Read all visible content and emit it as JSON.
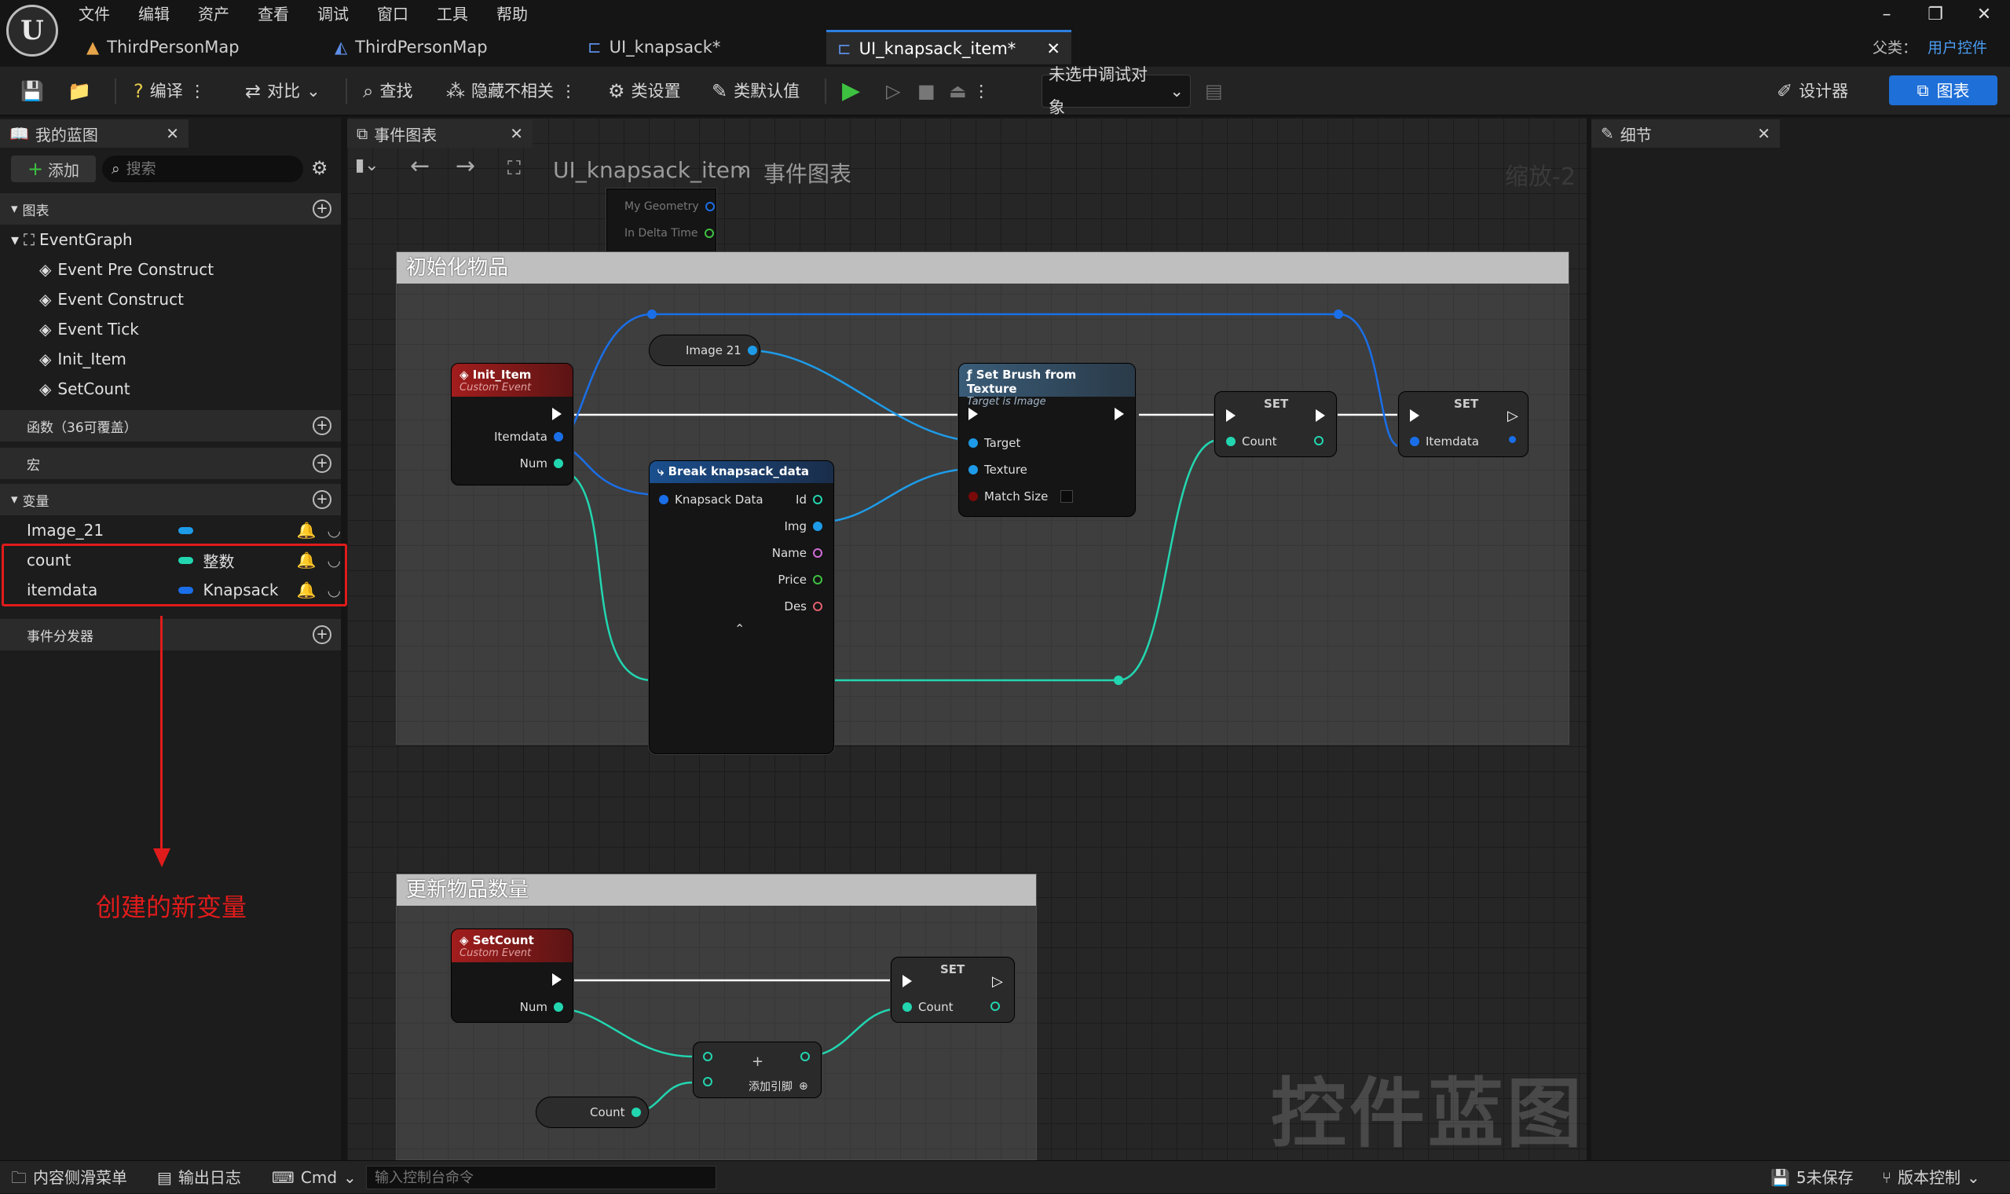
{
  "app": {
    "logo": "U",
    "menu": [
      "文件",
      "编辑",
      "资产",
      "查看",
      "调试",
      "窗口",
      "工具",
      "帮助"
    ],
    "tabs": [
      {
        "label": "ThirdPersonMap",
        "icon": "map-icon"
      },
      {
        "label": "ThirdPersonMap",
        "icon": "level-icon"
      },
      {
        "label": "UI_knapsack*",
        "icon": "widget-icon"
      },
      {
        "label": "UI_knapsack_item*",
        "icon": "widget-icon"
      }
    ],
    "parent_label": "父类：",
    "parent_value": "用户控件"
  },
  "toolbar": {
    "compile": "编译",
    "diff": "对比",
    "find": "查找",
    "hide": "隐藏不相关",
    "class_settings": "类设置",
    "class_defaults": "类默认值",
    "debug_target": "未选中调试对象",
    "designer": "设计器",
    "graph": "图表"
  },
  "mybp": {
    "title": "我的蓝图",
    "add": "添加",
    "search_placeholder": "搜索",
    "graphs": "图表",
    "eventgraph": "EventGraph",
    "events": [
      "Event Pre Construct",
      "Event Construct",
      "Event Tick",
      "Init_Item",
      "SetCount"
    ],
    "functions": "函数（36可覆盖）",
    "macros": "宏",
    "variables": "变量",
    "vars": [
      {
        "name": "Image_21",
        "type": "",
        "color": "#1e9be8"
      },
      {
        "name": "count",
        "type": "整数",
        "color": "#22d6b0"
      },
      {
        "name": "itemdata",
        "type": "Knapsack",
        "color": "#1a6fe8"
      }
    ],
    "dispatchers": "事件分发器"
  },
  "annotation": "创建的新变量",
  "graph": {
    "tab": "事件图表",
    "path_bp": "UI_knapsack_item",
    "path_graph": "事件图表",
    "zoom": "缩放-2",
    "watermark": "控件蓝图",
    "prev_pins": [
      "My Geometry",
      "In Delta Time"
    ],
    "comment1": "初始化物品",
    "comment2": "更新物品数量",
    "init_item": {
      "title": "Init_Item",
      "sub": "Custom Event",
      "pins": [
        "Itemdata",
        "Num"
      ]
    },
    "image21": "Image 21",
    "break": {
      "title": "Break knapsack_data",
      "in": "Knapsack Data",
      "outs": [
        "Id",
        "Img",
        "Name",
        "Price",
        "Des"
      ]
    },
    "setbrush": {
      "title": "Set Brush from Texture",
      "sub": "Target is Image",
      "pins": [
        "Target",
        "Texture",
        "Match Size"
      ]
    },
    "set1": {
      "title": "SET",
      "pin": "Count"
    },
    "set2": {
      "title": "SET",
      "pin": "Itemdata"
    },
    "setcount": {
      "title": "SetCount",
      "sub": "Custom Event",
      "pin": "Num"
    },
    "set3": {
      "title": "SET",
      "pin": "Count"
    },
    "add_node": {
      "label": "添加引脚"
    },
    "count_get": "Count"
  },
  "details": {
    "title": "细节"
  },
  "status": {
    "content": "内容侧滑菜单",
    "log": "输出日志",
    "cmd": "Cmd",
    "cmd_placeholder": "输入控制台命令",
    "unsaved": "5未保存",
    "source": "版本控制"
  }
}
